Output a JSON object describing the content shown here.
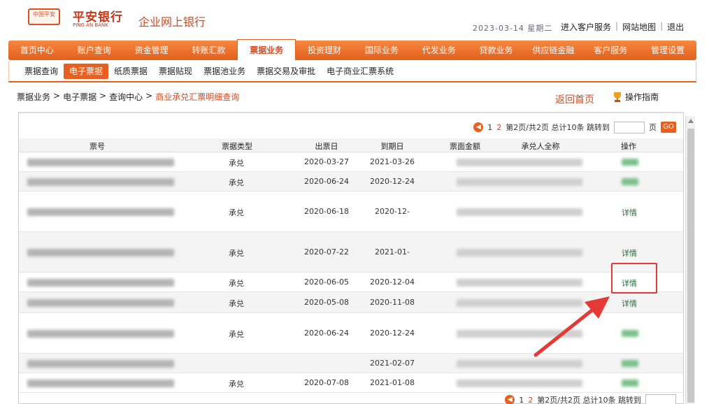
{
  "header": {
    "logo_text": "中国平安",
    "bank_name": "平安银行",
    "bank_sub": "PING AN BANK",
    "portal_name": "企业网上银行",
    "date": "2023-03-14 星期二",
    "links": [
      "进入客户服务",
      "网站地图",
      "退出"
    ]
  },
  "main_nav": {
    "items": [
      "首页中心",
      "账户查询",
      "资金管理",
      "转账汇款",
      "票据业务",
      "投资理财",
      "国际业务",
      "代发业务",
      "贷款业务",
      "供应链金融",
      "客户服务",
      "管理设置"
    ],
    "active_index": 4
  },
  "sub_nav": {
    "items": [
      "票据查询",
      "电子票据",
      "纸质票据",
      "票据贴现",
      "票据池业务",
      "票据交易及审批",
      "电子商业汇票系统"
    ],
    "active_index": 1
  },
  "breadcrumb": {
    "items": [
      "票据业务",
      "电子票据",
      "查询中心"
    ],
    "current": "商业承兑汇票明细查询"
  },
  "toolbar": {
    "return_label": "返回首页",
    "help_label": "操作指南"
  },
  "pager": {
    "prev": "◀",
    "pages": [
      "1",
      "2"
    ],
    "current_page": "2",
    "summary": "第2页/共2页 总计10条 跳转到",
    "suffix": "页",
    "go_label": "GO"
  },
  "table": {
    "columns": [
      "票号",
      "票据类型",
      "出票日",
      "到期日",
      "票面金额",
      "承兑人全称",
      "操作"
    ],
    "rows": [
      {
        "type": "承兑",
        "issue": "2020-03-27",
        "due": "2021-03-26",
        "action": ""
      },
      {
        "type": "承兑",
        "issue": "2020-06-24",
        "due": "2020-12-24",
        "action": ""
      },
      {
        "type": "承兑",
        "issue": "2020-06-18",
        "due": "2020-12-",
        "action": "详情"
      },
      {
        "type": "承兑",
        "issue": "2020-07-22",
        "due": "2021-01-",
        "action": "详情"
      },
      {
        "type": "承兑",
        "issue": "2020-06-05",
        "due": "2020-12-04",
        "action": "详情"
      },
      {
        "type": "承兑",
        "issue": "2020-05-08",
        "due": "2020-11-08",
        "action": "详情"
      },
      {
        "type": "承兑",
        "issue": "2020-06-24",
        "due": "2020-12-24",
        "action": ""
      },
      {
        "type": "",
        "issue": "",
        "due": "2021-02-07",
        "action": ""
      },
      {
        "type": "承兑",
        "issue": "2020-07-08",
        "due": "2021-01-08",
        "action": ""
      }
    ]
  },
  "colors": {
    "brand_orange": "#e8601f",
    "brand_red": "#c8371b",
    "highlight_red": "#e53935"
  }
}
